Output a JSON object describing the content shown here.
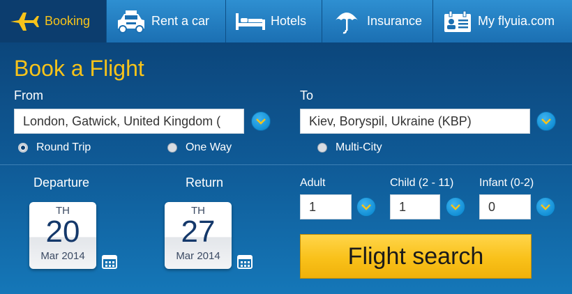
{
  "tabs": [
    {
      "label": "Booking",
      "icon": "airplane-icon"
    },
    {
      "label": "Rent a car",
      "icon": "car-icon"
    },
    {
      "label": "Hotels",
      "icon": "bed-icon"
    },
    {
      "label": "Insurance",
      "icon": "umbrella-icon"
    },
    {
      "label": "My flyuia.com",
      "icon": "id-card-icon"
    }
  ],
  "form": {
    "title": "Book a Flight",
    "from_label": "From",
    "from_value": "London, Gatwick, United Kingdom (",
    "to_label": "To",
    "to_value": "Kiev, Boryspil, Ukraine (KBP)",
    "trip_types": [
      "Round Trip",
      "One Way",
      "Multi-City"
    ],
    "selected_trip_type": "Round Trip",
    "departure": {
      "label": "Departure",
      "dow": "TH",
      "day": "20",
      "month_year": "Mar 2014"
    },
    "return": {
      "label": "Return",
      "dow": "TH",
      "day": "27",
      "month_year": "Mar 2014"
    },
    "passengers": {
      "adult_label": "Adult",
      "adult_value": "1",
      "child_label": "Child (2 - 11)",
      "child_value": "1",
      "infant_label": "Infant (0-2)",
      "infant_value": "0"
    },
    "search_label": "Flight search"
  },
  "colors": {
    "accent": "#f7c31a",
    "tab_blue": "#1b6fb2",
    "active_tab": "#0c3d6e",
    "background_top": "#0b3f72",
    "background_bottom": "#1577b8"
  }
}
